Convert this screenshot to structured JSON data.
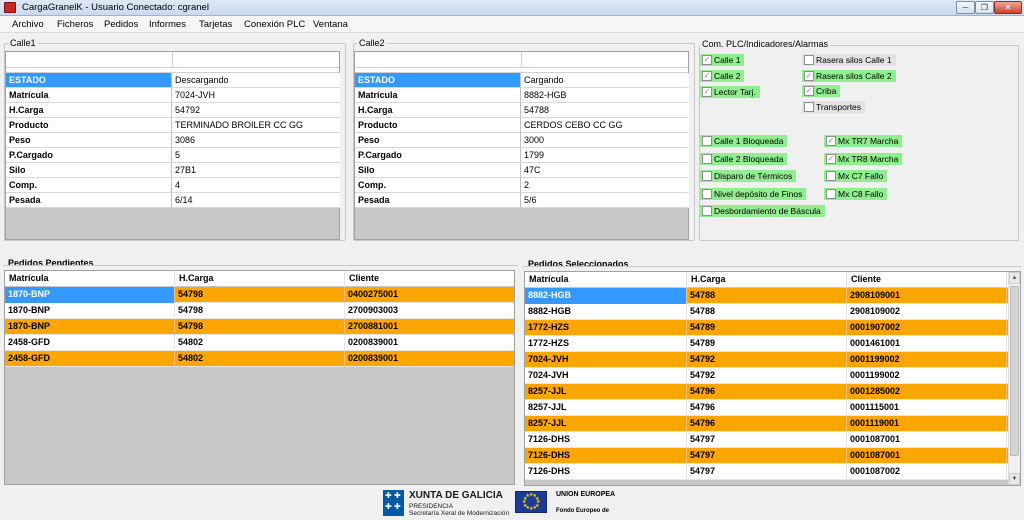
{
  "window": {
    "title": "CargaGranelK - Usuario Conectado: cgranel"
  },
  "menu": [
    "Archivo",
    "Ficheros",
    "Pedidos",
    "Informes",
    "Tarjetas",
    "Conexión PLC",
    "Ventana"
  ],
  "calle1": {
    "title": "Calle1",
    "rows": [
      {
        "key": "ESTADO",
        "value": "Descargando"
      },
      {
        "key": "Matrícula",
        "value": "7024-JVH"
      },
      {
        "key": "H.Carga",
        "value": "54792"
      },
      {
        "key": "Producto",
        "value": "TERMINADO BROILER CC GG"
      },
      {
        "key": "Peso",
        "value": "3086"
      },
      {
        "key": "P.Cargado",
        "value": "5"
      },
      {
        "key": "Silo",
        "value": "27B1"
      },
      {
        "key": "Comp.",
        "value": "4"
      },
      {
        "key": "Pesada",
        "value": "6/14"
      }
    ]
  },
  "calle2": {
    "title": "Calle2",
    "rows": [
      {
        "key": "ESTADO",
        "value": "Cargando"
      },
      {
        "key": "Matrícula",
        "value": "8882-HGB"
      },
      {
        "key": "H.Carga",
        "value": "54788"
      },
      {
        "key": "Producto",
        "value": "CERDOS CEBO CC GG"
      },
      {
        "key": "Peso",
        "value": "3000"
      },
      {
        "key": "P.Cargado",
        "value": "1799"
      },
      {
        "key": "Silo",
        "value": "47C"
      },
      {
        "key": "Comp.",
        "value": "2"
      },
      {
        "key": "Pesada",
        "value": "5/6"
      }
    ]
  },
  "plc": {
    "title": "Com. PLC/Indicadores/Alarmas",
    "left_top": [
      {
        "label": "Calle 1",
        "checked": true,
        "active": true
      },
      {
        "label": "Calle 2",
        "checked": true,
        "active": true
      },
      {
        "label": "Lector Tarj.",
        "checked": true,
        "active": true
      }
    ],
    "right_top": [
      {
        "label": "Rasera silos Calle 1",
        "checked": false,
        "active": false
      },
      {
        "label": "Rasera silos Calle 2",
        "checked": true,
        "active": true
      },
      {
        "label": "Criba",
        "checked": true,
        "active": true
      },
      {
        "label": "Transportes",
        "checked": false,
        "active": false
      }
    ],
    "left_bottom": [
      {
        "label": "Calle 1 Bloqueada",
        "checked": false,
        "active": true
      },
      {
        "label": "Calle 2 Bloqueada",
        "checked": false,
        "active": true
      },
      {
        "label": "Disparo de Térmicos",
        "checked": false,
        "active": true
      },
      {
        "label": "Nivel depósito de Finos",
        "checked": false,
        "active": true
      },
      {
        "label": "Desbordamiento de Báscula",
        "checked": false,
        "active": true
      }
    ],
    "right_bottom": [
      {
        "label": "Mx TR7 Marcha",
        "checked": true,
        "active": true
      },
      {
        "label": "Mx TR8 Marcha",
        "checked": true,
        "active": true
      },
      {
        "label": "Mx C7 Fallo",
        "checked": false,
        "active": true
      },
      {
        "label": "Mx C8 Fallo",
        "checked": false,
        "active": true
      }
    ]
  },
  "pendientes": {
    "title": "Pedidos Pendientes",
    "columns": [
      "Matrícula",
      "H.Carga",
      "Cliente"
    ],
    "rows": [
      {
        "cells": [
          "1870-BNP",
          "54798",
          "0400275001"
        ],
        "color": "orange",
        "selected": true
      },
      {
        "cells": [
          "1870-BNP",
          "54798",
          "2700903003"
        ],
        "color": "white",
        "selected": false
      },
      {
        "cells": [
          "1870-BNP",
          "54798",
          "2700881001"
        ],
        "color": "orange",
        "selected": false
      },
      {
        "cells": [
          "2458-GFD",
          "54802",
          "0200839001"
        ],
        "color": "white",
        "selected": false
      },
      {
        "cells": [
          "2458-GFD",
          "54802",
          "0200839001"
        ],
        "color": "orange",
        "selected": false
      }
    ]
  },
  "seleccionados": {
    "title": "Pedidos Seleccionados",
    "columns": [
      "Matrícula",
      "H.Carga",
      "Cliente"
    ],
    "rows": [
      {
        "cells": [
          "8882-HGB",
          "54788",
          "2908109001"
        ],
        "color": "orange",
        "selected": true
      },
      {
        "cells": [
          "8882-HGB",
          "54788",
          "2908109002"
        ],
        "color": "white",
        "selected": false
      },
      {
        "cells": [
          "1772-HZS",
          "54789",
          "0001907002"
        ],
        "color": "orange",
        "selected": false
      },
      {
        "cells": [
          "1772-HZS",
          "54789",
          "0001461001"
        ],
        "color": "white",
        "selected": false
      },
      {
        "cells": [
          "7024-JVH",
          "54792",
          "0001199002"
        ],
        "color": "orange",
        "selected": false
      },
      {
        "cells": [
          "7024-JVH",
          "54792",
          "0001199002"
        ],
        "color": "white",
        "selected": false
      },
      {
        "cells": [
          "8257-JJL",
          "54796",
          "0001285002"
        ],
        "color": "orange",
        "selected": false
      },
      {
        "cells": [
          "8257-JJL",
          "54796",
          "0001115001"
        ],
        "color": "white",
        "selected": false
      },
      {
        "cells": [
          "8257-JJL",
          "54796",
          "0001119001"
        ],
        "color": "orange",
        "selected": false
      },
      {
        "cells": [
          "7126-DHS",
          "54797",
          "0001087001"
        ],
        "color": "white",
        "selected": false
      },
      {
        "cells": [
          "7126-DHS",
          "54797",
          "0001087001"
        ],
        "color": "orange",
        "selected": false
      },
      {
        "cells": [
          "7126-DHS",
          "54797",
          "0001087002"
        ],
        "color": "white",
        "selected": false
      }
    ]
  },
  "footer": {
    "xunta_name": "XUNTA DE GALICIA",
    "xunta_line1": "PRESIDENCIA",
    "xunta_line2": "Secretaría Xeral de Modernización",
    "eu_name": "UNION EUROPEA",
    "eu_line1": "Fondo Europeo de"
  },
  "colors": {
    "selection": "#3399ff",
    "highlight_row": "#ffa500",
    "indicator_on": "#90ee90",
    "indicator_off": "#e2e2e2"
  }
}
